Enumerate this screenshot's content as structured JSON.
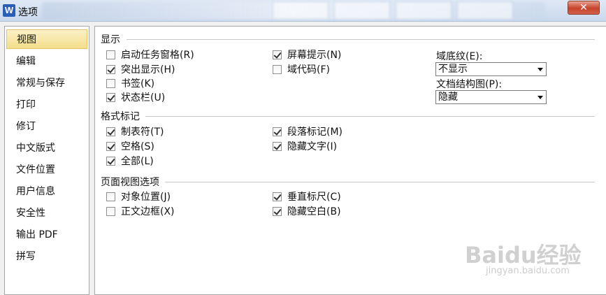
{
  "window": {
    "title": "选项",
    "close_glyph": "✕"
  },
  "sidebar": {
    "items": [
      {
        "label": "视图",
        "active": true
      },
      {
        "label": "编辑"
      },
      {
        "label": "常规与保存"
      },
      {
        "label": "打印"
      },
      {
        "label": "修订"
      },
      {
        "label": "中文版式"
      },
      {
        "label": "文件位置"
      },
      {
        "label": "用户信息"
      },
      {
        "label": "安全性"
      },
      {
        "label": "输出 PDF"
      },
      {
        "label": "拼写"
      }
    ]
  },
  "display": {
    "title": "显示",
    "options": {
      "startup_taskpane": {
        "label": "启动任务窗格(R)",
        "checked": false
      },
      "highlight": {
        "label": "突出显示(H)",
        "checked": true
      },
      "bookmarks": {
        "label": "书签(K)",
        "checked": false
      },
      "statusbar": {
        "label": "状态栏(U)",
        "checked": true
      },
      "screen_tips": {
        "label": "屏幕提示(N)",
        "checked": true
      },
      "field_codes": {
        "label": "域代码(F)",
        "checked": false
      }
    },
    "field_shading": {
      "label": "域底纹(E):",
      "value": "不显示"
    },
    "doc_map": {
      "label": "文档结构图(P):",
      "value": "隐藏"
    }
  },
  "format_marks": {
    "title": "格式标记",
    "options": {
      "tabs": {
        "label": "制表符(T)",
        "checked": true
      },
      "spaces": {
        "label": "空格(S)",
        "checked": true
      },
      "all": {
        "label": "全部(L)",
        "checked": true
      },
      "paragraph": {
        "label": "段落标记(M)",
        "checked": true
      },
      "hidden_text": {
        "label": "隐藏文字(I)",
        "checked": true
      }
    }
  },
  "page_view": {
    "title": "页面视图选项",
    "options": {
      "object_anchors": {
        "label": "对象位置(J)",
        "checked": false
      },
      "text_boundaries": {
        "label": "正文边框(X)",
        "checked": false
      },
      "vertical_ruler": {
        "label": "垂直标尺(C)",
        "checked": true
      },
      "hide_whitespace": {
        "label": "隐藏空白(B)",
        "checked": true
      }
    }
  },
  "watermark": {
    "brand": "Baidu经验",
    "url": "jingyan.baidu.com"
  }
}
